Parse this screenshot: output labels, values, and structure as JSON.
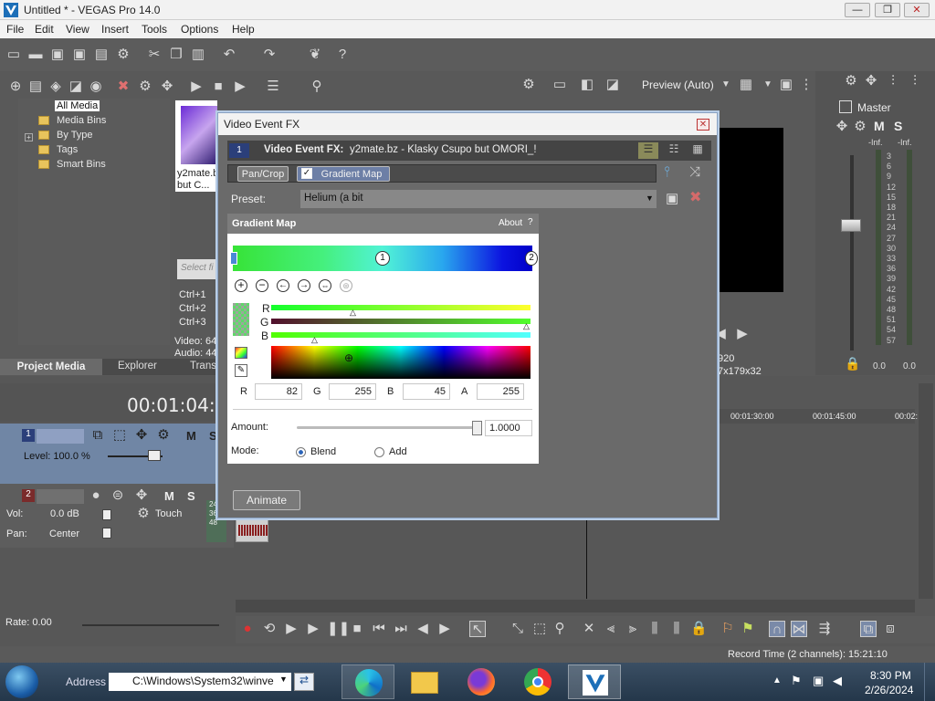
{
  "window": {
    "title": "Untitled * - VEGAS Pro 14.0"
  },
  "menu": [
    "File",
    "Edit",
    "View",
    "Insert",
    "Tools",
    "Options",
    "Help"
  ],
  "media_tree": {
    "items": [
      "All Media",
      "Media Bins",
      "By Type",
      "Tags",
      "Smart Bins"
    ],
    "thumb_caption": "y2mate.b... but C...",
    "search_placeholder": "Select fi",
    "shortcuts": [
      "Ctrl+1",
      "Ctrl+2",
      "Ctrl+3"
    ],
    "info_video": "Video: 64",
    "info_audio": "Audio: 44"
  },
  "tabs": {
    "project_media": "Project Media",
    "explorer": "Explorer",
    "transitions": "Transi"
  },
  "preview": {
    "label": "Preview (Auto)",
    "dims_a": "920",
    "dims_b": "7x179x32"
  },
  "master": {
    "label": "Master",
    "m": "M",
    "s": "S",
    "inf1": "-Inf.",
    "inf2": "-Inf.",
    "scale": [
      "3",
      "6",
      "9",
      "12",
      "15",
      "18",
      "21",
      "24",
      "27",
      "30",
      "33",
      "36",
      "39",
      "42",
      "45",
      "48",
      "51",
      "54",
      "57"
    ],
    "bottom1": "0.0",
    "bottom2": "0.0"
  },
  "timecode": "00:01:04:0",
  "ruler": [
    "00:01:30:00",
    "00:01:45:00",
    "00:02:"
  ],
  "track1": {
    "num": "1",
    "level": "Level: 100.0 %",
    "m": "M",
    "s": "S"
  },
  "track2": {
    "num": "2",
    "vol": "Vol:",
    "vol_val": "0.0 dB",
    "pan": "Pan:",
    "pan_val": "Center",
    "touch": "Touch",
    "m": "M",
    "s": "S",
    "scale": [
      "24",
      "36",
      "48"
    ]
  },
  "rate": "Rate: 0.00",
  "status": {
    "record_time": "Record Time (2 channels): 15:21:10"
  },
  "taskbar": {
    "address_label": "Address",
    "address_value": "C:\\Windows\\System32\\winve",
    "time": "8:30 PM",
    "date": "2/26/2024"
  },
  "dialog": {
    "title": "Video Event FX",
    "track_num": "1",
    "fx_label": "Video Event FX:",
    "fx_name": "y2mate.bz - Klasky Csupo but OMORI_!",
    "chain": [
      "Pan/Crop",
      "Gradient Map"
    ],
    "preset_label": "Preset:",
    "preset_value": "Helium (a bit",
    "plugin_title": "Gradient Map",
    "about": "About",
    "help": "?",
    "stops": [
      "1",
      "2"
    ],
    "channels": [
      "R",
      "G",
      "B"
    ],
    "rgba": {
      "r_label": "R",
      "r": "82",
      "g_label": "G",
      "g": "255",
      "b_label": "B",
      "b": "45",
      "a_label": "A",
      "a": "255"
    },
    "amount_label": "Amount:",
    "amount_value": "1.0000",
    "mode_label": "Mode:",
    "mode_blend": "Blend",
    "mode_add": "Add",
    "animate": "Animate"
  }
}
